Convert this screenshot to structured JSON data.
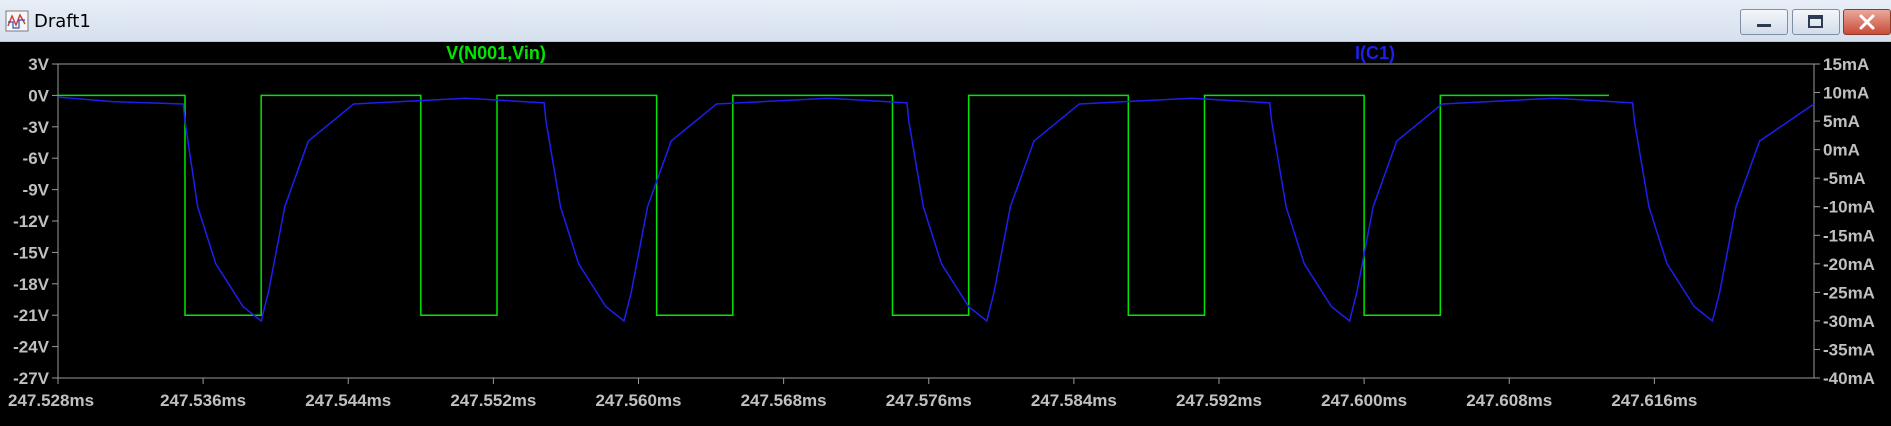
{
  "window": {
    "title": "Draft1"
  },
  "icons": {
    "app": "waveform-app-icon",
    "minimize": "minimize-icon",
    "maximize": "maximize-icon",
    "close": "close-icon"
  },
  "colors": {
    "background": "#000000",
    "axis_text": "#c0c0c0",
    "voltage_trace": "#00e600",
    "current_trace": "#1e1ef0"
  },
  "chart_data": {
    "type": "line",
    "title": "",
    "x_unit": "ms",
    "xlim": [
      247.528,
      247.6248
    ],
    "x_ticks": [
      "247.528ms",
      "247.536ms",
      "247.544ms",
      "247.552ms",
      "247.560ms",
      "247.568ms",
      "247.576ms",
      "247.584ms",
      "247.592ms",
      "247.600ms",
      "247.608ms",
      "247.616ms"
    ],
    "y_left": {
      "label": "V(N001,Vin)",
      "unit": "V",
      "ylim": [
        -27,
        3
      ],
      "ticks": [
        "3V",
        "0V",
        "-3V",
        "-6V",
        "-9V",
        "-12V",
        "-15V",
        "-18V",
        "-21V",
        "-24V",
        "-27V"
      ]
    },
    "y_right": {
      "label": "I(C1)",
      "unit": "mA",
      "ylim": [
        -40,
        15
      ],
      "ticks": [
        "15mA",
        "10mA",
        "5mA",
        "0mA",
        "-5mA",
        "-10mA",
        "-15mA",
        "-20mA",
        "-25mA",
        "-30mA",
        "-35mA",
        "-40mA"
      ]
    },
    "series": [
      {
        "name": "V(N001,Vin)",
        "axis": "left",
        "x": [
          247.528,
          247.535,
          247.535,
          247.5392,
          247.5392,
          247.548,
          247.548,
          247.5522,
          247.5522,
          247.561,
          247.561,
          247.5652,
          247.5652,
          247.574,
          247.574,
          247.5782,
          247.5782,
          247.587,
          247.587,
          247.5912,
          247.5912,
          247.6,
          247.6,
          247.6042,
          247.6042,
          247.6135
        ],
        "y": [
          0,
          0,
          -21,
          -21,
          0,
          0,
          -21,
          -21,
          0,
          0,
          -21,
          -21,
          0,
          0,
          -21,
          -21,
          0,
          0,
          -21,
          -21,
          0,
          0,
          -21,
          -21,
          0,
          0
        ]
      },
      {
        "name": "I(C1)",
        "axis": "right",
        "x": [
          247.528,
          247.531,
          247.5349,
          247.535,
          247.5357,
          247.5367,
          247.5382,
          247.5392,
          247.5396,
          247.5405,
          247.5418,
          247.5443,
          247.5505,
          247.5548,
          247.5549,
          247.5557,
          247.5567,
          247.5582,
          247.5592,
          247.5596,
          247.5605,
          247.5618,
          247.5643,
          247.5705,
          247.5748,
          247.5749,
          247.5757,
          247.5767,
          247.5782,
          247.5792,
          247.5796,
          247.5805,
          247.5818,
          247.5843,
          247.5905,
          247.5948,
          247.5949,
          247.5957,
          247.5967,
          247.5982,
          247.5992,
          247.5996,
          247.6005,
          247.6018,
          247.6043,
          247.6105,
          247.6148,
          247.6149,
          247.6157,
          247.6167,
          247.6182,
          247.6192,
          247.6196,
          247.6205,
          247.6218,
          247.6248
        ],
        "y": [
          9.2,
          8.4,
          8.0,
          5.0,
          -10.0,
          -20.0,
          -27.5,
          -30.0,
          -25.0,
          -10.0,
          1.5,
          8.0,
          9.0,
          8.2,
          5.0,
          -10.0,
          -20.0,
          -27.5,
          -30.0,
          -25.0,
          -10.0,
          1.5,
          8.0,
          9.0,
          8.2,
          5.0,
          -10.0,
          -20.0,
          -27.5,
          -30.0,
          -25.0,
          -10.0,
          1.5,
          8.0,
          9.0,
          8.2,
          5.0,
          -10.0,
          -20.0,
          -27.5,
          -30.0,
          -25.0,
          -10.0,
          1.5,
          8.0,
          9.0,
          8.2,
          5.0,
          -10.0,
          -20.0,
          -27.5,
          -30.0,
          -25.0,
          -10.0,
          1.5,
          8.0
        ]
      }
    ],
    "grid": false,
    "legend": "top labels above plot"
  }
}
